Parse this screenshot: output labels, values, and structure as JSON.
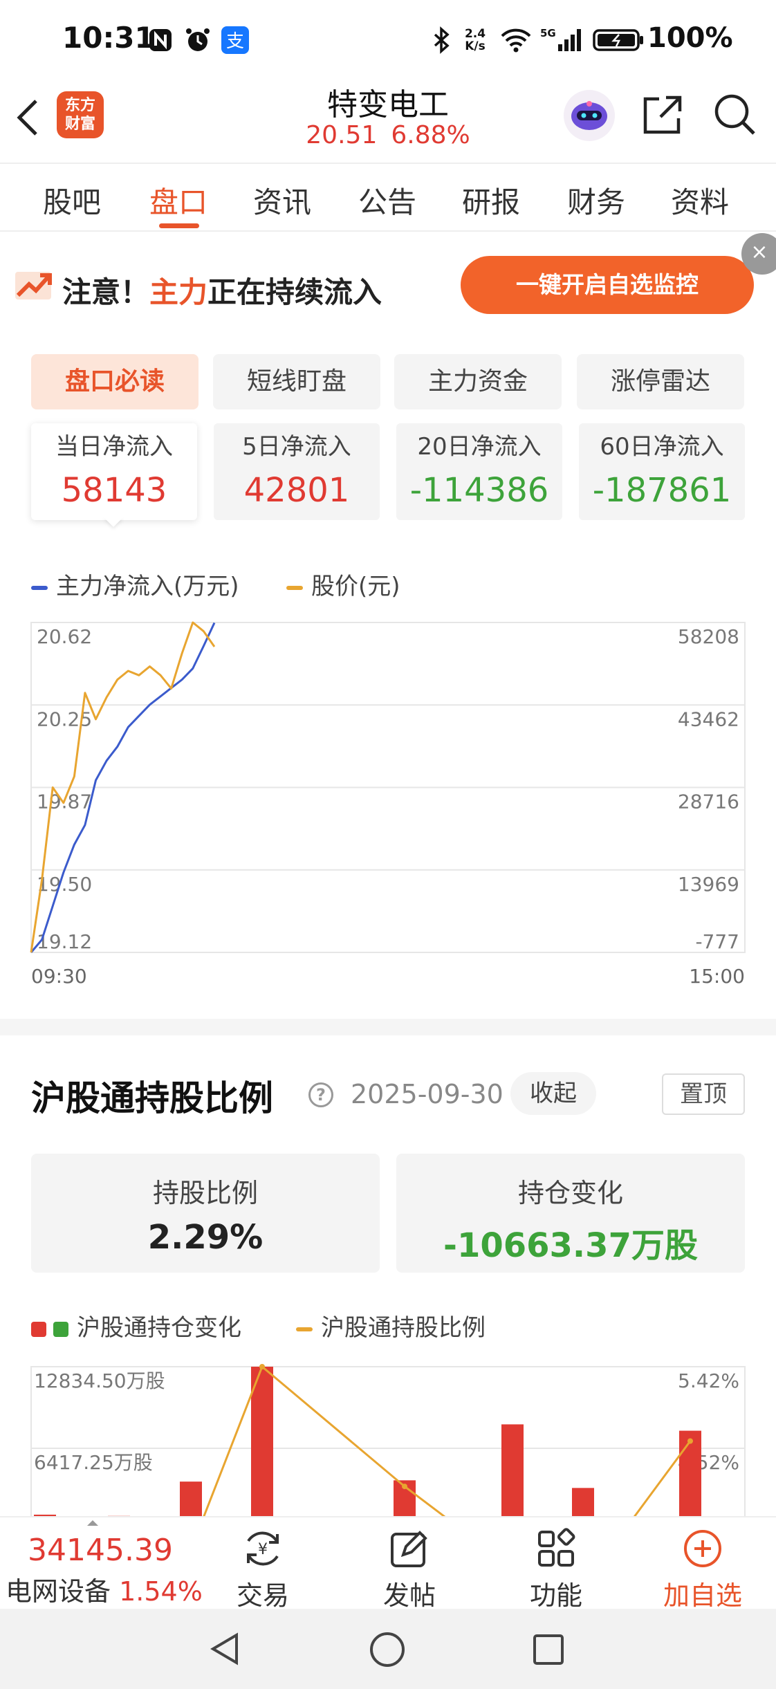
{
  "status_bar": {
    "time": "10:31",
    "net_speed_top": "2.4",
    "net_speed_bottom": "K/s",
    "network": "5G",
    "battery": "100%",
    "icons": [
      "nfc-icon",
      "alarm-icon",
      "alipay-icon",
      "bluetooth-icon",
      "wifi-icon",
      "signal-icon",
      "battery-icon"
    ]
  },
  "header": {
    "logo_line1": "东方",
    "logo_line2": "财富",
    "stock_name": "特变电工",
    "price": "20.51",
    "change_pct": "6.88%"
  },
  "tabs": [
    "股吧",
    "盘口",
    "资讯",
    "公告",
    "研报",
    "财务",
    "资料"
  ],
  "active_tab": "盘口",
  "banner": {
    "prefix": "注意！",
    "highlight": "主力",
    "suffix": "正在持续流入",
    "button": "一键开启自选监控",
    "close": "×"
  },
  "sub_tabs": [
    "盘口必读",
    "短线盯盘",
    "主力资金",
    "涨停雷达"
  ],
  "flow_cards": [
    {
      "label": "当日净流入",
      "value": "58143"
    },
    {
      "label": "5日净流入",
      "value": "42801"
    },
    {
      "label": "20日净流入",
      "value": "-114386"
    },
    {
      "label": "60日净流入",
      "value": "-187861"
    }
  ],
  "flow_legend": {
    "series1": "主力净流入(万元)",
    "series2": "股价(元)"
  },
  "colors": {
    "accent": "#e8542a",
    "up": "#e03a32",
    "down": "#3da33a",
    "line_blue": "#3b5bcc",
    "line_gold": "#e8a530"
  },
  "chart_data": [
    {
      "type": "line",
      "x_start": "09:30",
      "x_end": "15:00",
      "left_ticks": [
        "20.62",
        "20.25",
        "19.87",
        "19.50",
        "19.12"
      ],
      "right_ticks": [
        "58208",
        "43462",
        "28716",
        "13969",
        "-777"
      ],
      "ylim_left": [
        19.12,
        20.62
      ],
      "ylim_right": [
        -777,
        58208
      ],
      "series": [
        {
          "name": "主力净流入(万元)",
          "axis": "right",
          "color": "#3b5bcc",
          "values": [
            -777,
            1500,
            7500,
            13500,
            18500,
            22000,
            30000,
            33500,
            36000,
            39500,
            41500,
            43500,
            45000,
            46500,
            48000,
            50000,
            54000,
            58143
          ]
        },
        {
          "name": "股价(元)",
          "axis": "left",
          "color": "#e8a530",
          "values": [
            19.12,
            19.45,
            19.87,
            19.8,
            19.92,
            20.3,
            20.18,
            20.28,
            20.36,
            20.4,
            20.38,
            20.42,
            20.38,
            20.32,
            20.48,
            20.62,
            20.58,
            20.51
          ]
        }
      ]
    },
    {
      "type": "bar",
      "series": [
        {
          "name": "沪股通持仓变化",
          "axis": "left",
          "color": "#e03a32",
          "values": [
            1200,
            1100,
            3800,
            12834.5,
            3900,
            8300,
            3300,
            7800
          ]
        },
        {
          "name": "沪股通持股比例",
          "axis": "right",
          "color": "#e8a530",
          "values": [
            3.3,
            3.3,
            3.4,
            5.42,
            4.1,
            3.2,
            3.0,
            4.6
          ]
        }
      ],
      "left_ticks": [
        "12834.50万股",
        "6417.25万股"
      ],
      "right_ticks": [
        "5.42%",
        "4.52%"
      ]
    }
  ],
  "hk_section": {
    "title": "沪股通持股比例",
    "date": "2025-09-30",
    "collapse": "收起",
    "pin": "置顶",
    "ratio_label": "持股比例",
    "ratio_value": "2.29%",
    "change_label": "持仓变化",
    "change_value": "-10663.37万股",
    "legend1": "沪股通持仓变化",
    "legend2": "沪股通持股比例"
  },
  "bottom_bar": {
    "index_value": "34145.39",
    "index_name": "电网设备",
    "index_change": "1.54%",
    "items": [
      "交易",
      "发帖",
      "功能",
      "加自选"
    ]
  }
}
